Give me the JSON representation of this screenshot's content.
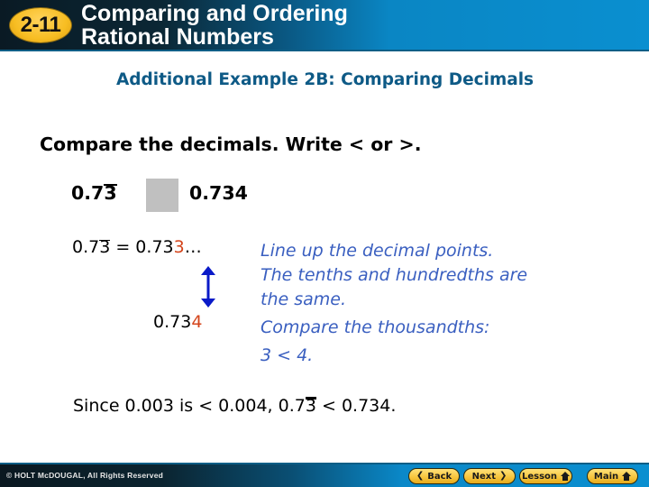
{
  "header": {
    "lesson_number": "2-11",
    "title_line1": "Comparing and Ordering",
    "title_line2": "Rational Numbers"
  },
  "subtitle": "Additional Example 2B: Comparing Decimals",
  "instruction": "Compare the decimals. Write < or >.",
  "problem": {
    "left_prefix": "0.7",
    "left_repeating_digit": "3",
    "answer_box": "",
    "right": "0.734"
  },
  "work": {
    "eq_prefix": "0.7",
    "eq_repeating_digit": "3",
    "eq_equals": " = 0.73",
    "eq_highlight_digit": "3",
    "eq_ellipsis": "…",
    "second_prefix": "0.73",
    "second_highlight_digit": "4",
    "arrow_icon": "double-vertical-arrow",
    "highlight_color": "#d4451c",
    "arrow_color": "#0a1ac8"
  },
  "explanation": {
    "line1": "Line up the decimal points.",
    "line2": "The tenths and hundredths are",
    "line3": "the same.",
    "line4": "Compare the thousandths:",
    "line5": "3 < 4.",
    "color": "#3a5fc0"
  },
  "conclusion": {
    "prefix": "Since 0.003 is < 0.004, 0.7",
    "repeating_digit": "3",
    "suffix": " < 0.734."
  },
  "footer": {
    "copyright": "© HOLT McDOUGAL, All Rights Reserved",
    "buttons": [
      {
        "label": "Back",
        "icon": "chevron-left"
      },
      {
        "label": "Next",
        "icon": "chevron-right"
      },
      {
        "label": "Lesson",
        "icon": "home"
      },
      {
        "label": "Main",
        "icon": "home"
      }
    ]
  }
}
